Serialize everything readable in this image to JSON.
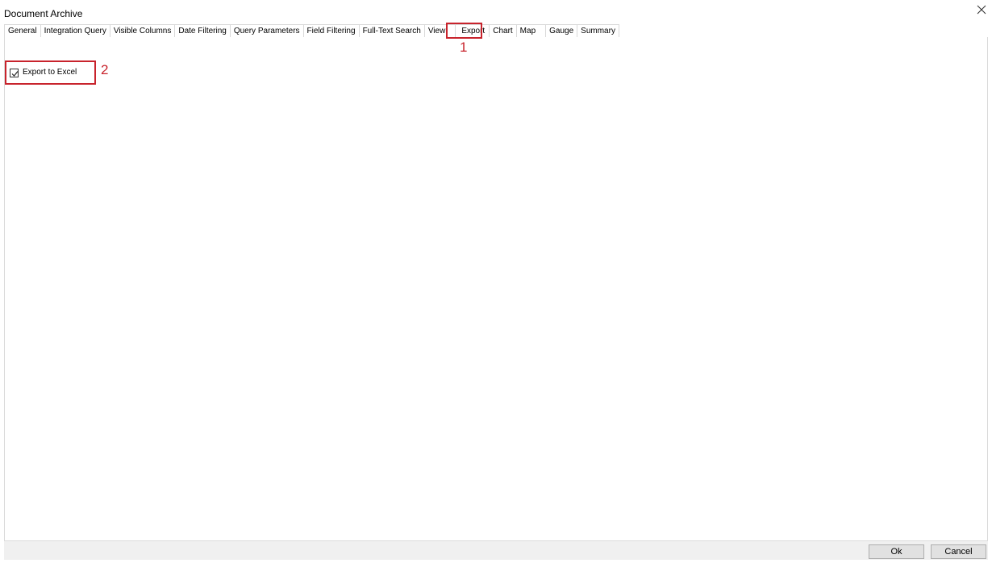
{
  "window": {
    "title": "Document Archive"
  },
  "tabs": [
    {
      "label": "General"
    },
    {
      "label": "Integration Query"
    },
    {
      "label": "Visible Columns"
    },
    {
      "label": "Date Filtering"
    },
    {
      "label": "Query Parameters"
    },
    {
      "label": "Field Filtering"
    },
    {
      "label": "Full-Text Search"
    },
    {
      "label": "View"
    },
    {
      "label": "Export",
      "active": true
    },
    {
      "label": "Chart"
    },
    {
      "label": "Map"
    },
    {
      "label": "Gauge"
    },
    {
      "label": "Summary"
    }
  ],
  "export_panel": {
    "export_to_excel_label": "Export to Excel",
    "export_to_excel_checked": true
  },
  "annotations": {
    "marker_1": "1",
    "marker_2": "2",
    "color": "#c8232c"
  },
  "footer": {
    "ok_label": "Ok",
    "cancel_label": "Cancel"
  }
}
